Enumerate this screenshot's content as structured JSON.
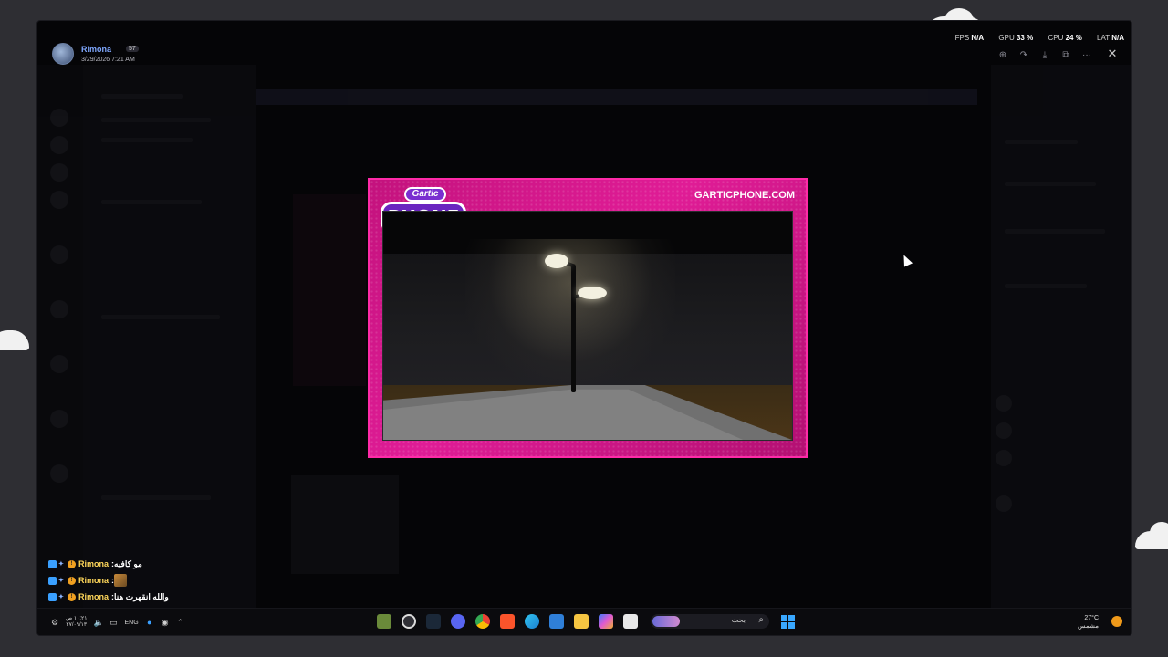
{
  "colors": {
    "background": "#2e2e33",
    "window_bg": "#050507",
    "card_pink": "#e01c96",
    "card_border": "#ff2aa8",
    "username_blue": "#7fa8ff",
    "chat_name_gold": "#ffd75a",
    "windows_blue": "#39a8ff"
  },
  "header": {
    "username": "Rimona",
    "badge": "57",
    "timestamp": "3/29/2026 7:21 AM",
    "avatar_icon": "avatar"
  },
  "perf": {
    "fps_label": "FPS",
    "fps_value": "N/A",
    "gpu_label": "GPU",
    "gpu_value": "33 %",
    "cpu_label": "CPU",
    "cpu_value": "24 %",
    "lat_label": "LAT",
    "lat_value": "N/A"
  },
  "toolbar": {
    "zoom_icon": "zoom-in-icon",
    "forward_icon": "forward-icon",
    "download_icon": "download-icon",
    "open_icon": "open-external-icon",
    "more_icon": "more-icon",
    "close_icon": "close-icon",
    "zoom_glyph": "⊕",
    "forward_glyph": "↷",
    "download_glyph": "⤓",
    "open_glyph": "⧉",
    "more_glyph": "···",
    "close_glyph": "✕"
  },
  "card": {
    "logo_top": "Gartic",
    "logo_bottom": "PHONE",
    "site": "GARTICPHONE.COM"
  },
  "chat": [
    {
      "name": "Rimona",
      "sep": " : ",
      "message": "مو كافيه"
    },
    {
      "name": "Rimona",
      "sep": " : ",
      "message": ""
    },
    {
      "name": "Rimona",
      "sep": " : ",
      "message": "والله انقهرت هنا"
    }
  ],
  "taskbar": {
    "clock_time": "١٠:٢١ ص",
    "clock_date": "٢٧/٠٩/١٣",
    "language": "ENG",
    "search_text": "بحث",
    "weather_temp": "27°C",
    "weather_desc": "مشمس"
  }
}
